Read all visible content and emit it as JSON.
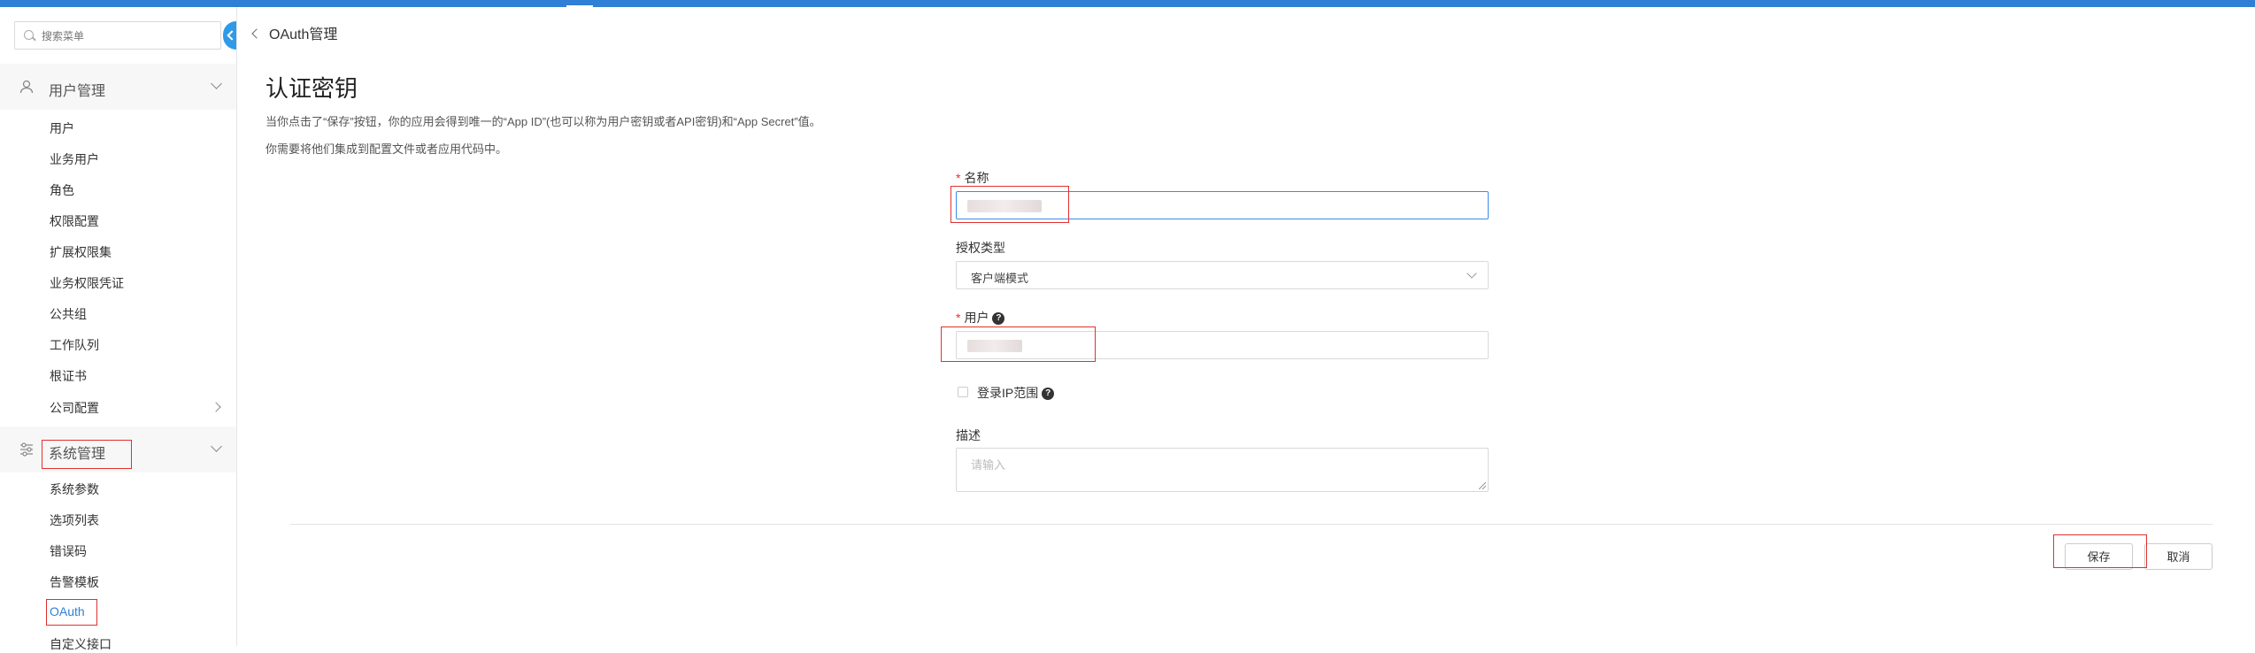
{
  "sidebar": {
    "search_placeholder": "搜索菜单",
    "groups": [
      {
        "label": "用户管理",
        "icon": "user-icon",
        "items": [
          "用户",
          "业务用户",
          "角色",
          "权限配置",
          "扩展权限集",
          "业务权限凭证",
          "公共组",
          "工作队列",
          "根证书",
          "公司配置"
        ]
      },
      {
        "label": "系统管理",
        "icon": "settings-sliders-icon",
        "items": [
          "系统参数",
          "选项列表",
          "错误码",
          "告警模板",
          "OAuth",
          "自定义接口"
        ]
      }
    ],
    "active_item": "OAuth"
  },
  "breadcrumb": {
    "label": "OAuth管理"
  },
  "page": {
    "title": "认证密钥",
    "desc1": "当你点击了“保存”按钮，你的应用会得到唯一的“App ID”(也可以称为用户密钥或者API密钥)和“App Secret”值。",
    "desc2": "你需要将他们集成到配置文件或者应用代码中。"
  },
  "form": {
    "required_mark": "*",
    "name_label": "名称",
    "grant_label": "授权类型",
    "grant_value": "客户端模式",
    "user_label": "用户",
    "ip_label": "登录IP范围",
    "help_glyph": "?",
    "desc_label": "描述",
    "desc_placeholder": "请输入"
  },
  "actions": {
    "save": "保存",
    "cancel": "取消"
  },
  "colors": {
    "accent": "#2f7fd6",
    "highlight": "#e0312f"
  }
}
